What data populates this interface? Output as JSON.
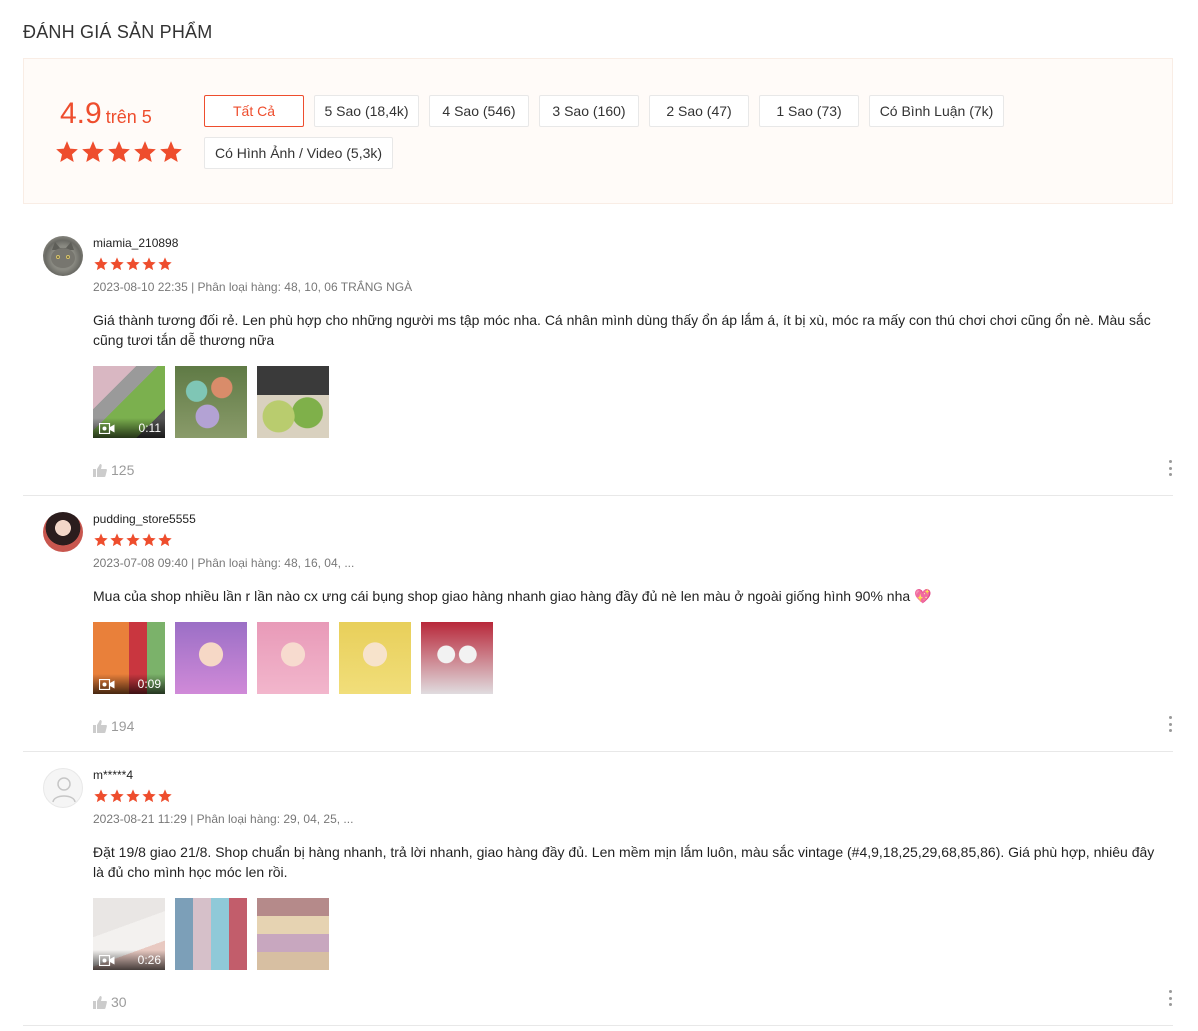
{
  "page_title": "ĐÁNH GIÁ SẢN PHẨM",
  "summary": {
    "score": "4.9",
    "score_suffix": "trên 5",
    "rating": 5,
    "filters": [
      {
        "label": "Tất Cả",
        "active": true
      },
      {
        "label": "5 Sao (18,4k)",
        "active": false
      },
      {
        "label": "4 Sao (546)",
        "active": false
      },
      {
        "label": "3 Sao (160)",
        "active": false
      },
      {
        "label": "2 Sao (47)",
        "active": false
      },
      {
        "label": "1 Sao (73)",
        "active": false
      },
      {
        "label": "Có Bình Luận (7k)",
        "active": false
      },
      {
        "label": "Có Hình Ảnh / Video (5,3k)",
        "active": false
      }
    ]
  },
  "colors": {
    "accent": "#ee4d2d",
    "summary_bg": "#fffbf8"
  },
  "reviews": [
    {
      "username": "miamia_210898",
      "rating": 5,
      "meta": "2023-08-10 22:35 | Phân loại hàng: 48, 10, 06 TRẮNG NGÀ",
      "comment": "Giá thành tương đối rẻ. Len phù hợp cho những người ms tập móc nha. Cá nhân mình dùng thấy ổn áp lắm á, ít bị xù, móc ra mấy con thú chơi chơi cũng ổn nè. Màu sắc cũng tươi tắn dễ thương nữa",
      "video_duration": "0:11",
      "likes": "125"
    },
    {
      "username": "pudding_store5555",
      "rating": 5,
      "meta": "2023-07-08 09:40 | Phân loại hàng: 48, 16, 04, ...",
      "comment": "Mua của shop nhiều lần r lần nào cx ưng cái bụng shop giao hàng nhanh giao hàng đầy đủ nè len màu ở ngoài giống hình 90% nha 💖",
      "video_duration": "0:09",
      "likes": "194"
    },
    {
      "username": "m*****4",
      "rating": 5,
      "meta": "2023-08-21 11:29 | Phân loại hàng: 29, 04, 25, ...",
      "comment": "Đặt 19/8 giao 21/8. Shop chuẩn bị hàng nhanh, trả lời nhanh, giao hàng đầy đủ. Len mềm mịn lắm luôn, màu sắc vintage (#4,9,18,25,29,68,85,86). Giá phù hợp, nhiêu đây là đủ cho mình học móc len rồi.",
      "video_duration": "0:26",
      "likes": "30"
    }
  ]
}
